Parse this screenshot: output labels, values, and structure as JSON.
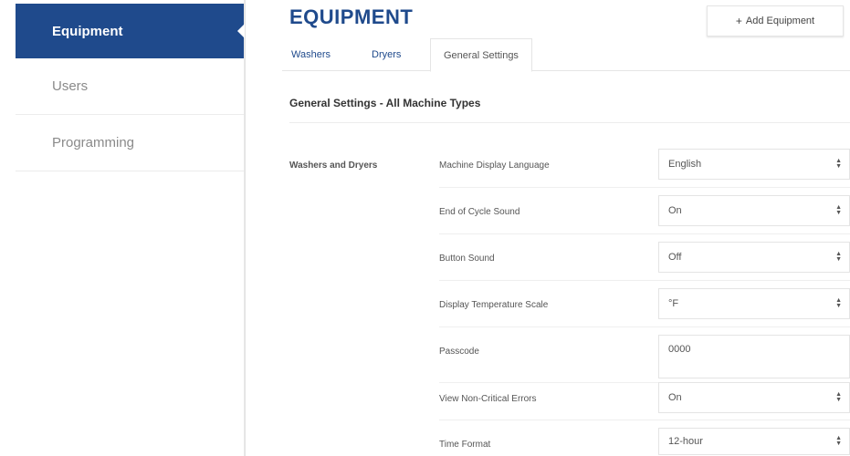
{
  "sidebar": {
    "items": [
      {
        "label": "Equipment",
        "active": true
      },
      {
        "label": "Users",
        "active": false
      },
      {
        "label": "Programming",
        "active": false
      }
    ]
  },
  "header": {
    "title": "EQUIPMENT",
    "add_button": "Add Equipment"
  },
  "tabs": [
    {
      "label": "Washers",
      "active": false
    },
    {
      "label": "Dryers",
      "active": false
    },
    {
      "label": "General Settings",
      "active": true
    }
  ],
  "section": {
    "title": "General Settings - All Machine Types",
    "group_label": "Washers and Dryers",
    "rows": [
      {
        "label": "Machine Display Language",
        "value": "English",
        "type": "select"
      },
      {
        "label": "End of Cycle Sound",
        "value": "On",
        "type": "select"
      },
      {
        "label": "Button Sound",
        "value": "Off",
        "type": "select"
      },
      {
        "label": "Display Temperature Scale",
        "value": "°F",
        "type": "select"
      },
      {
        "label": "Passcode",
        "value": "0000",
        "type": "input"
      },
      {
        "label": "View Non-Critical Errors",
        "value": "On",
        "type": "select"
      },
      {
        "label": "Time Format",
        "value": "12-hour",
        "type": "select"
      }
    ]
  },
  "colors": {
    "brand": "#1f4a8c",
    "sidebar_active_bg": "#1f4a8c"
  }
}
